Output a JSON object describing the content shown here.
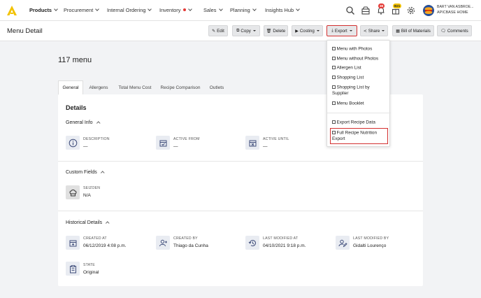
{
  "nav": {
    "items": [
      {
        "label": "Products"
      },
      {
        "label": "Procurement"
      },
      {
        "label": "Internal Ordering"
      },
      {
        "label": "Inventory"
      },
      {
        "label": "Sales"
      },
      {
        "label": "Planning"
      },
      {
        "label": "Insights Hub"
      }
    ],
    "badges": {
      "notifications": "38",
      "alerts": "B21"
    },
    "user": {
      "name": "BART VAN ASBROE...",
      "home": "APICBASE HOME"
    },
    "icons": [
      "search-icon",
      "inbox-icon",
      "bell-icon",
      "gift-icon",
      "gear-icon"
    ]
  },
  "toolbar": {
    "page_title": "Menu Detail",
    "edit": "Edit",
    "copy": "Copy",
    "delete": "Delete",
    "costing": "Costing",
    "export": "Export",
    "share": "Share",
    "bom": "Bill of Materials",
    "comments": "Comments"
  },
  "export_menu": {
    "items": [
      "Menu with Photos",
      "Menu without Photos",
      "Allergen List",
      "Shopping List",
      "Shopping List by",
      "Supplier",
      "Menu Booklet",
      "Export Recipe Data",
      "Full Recipe Nutrition",
      "Export"
    ]
  },
  "main": {
    "title": "117 menu",
    "tabs": [
      "General",
      "Allergens",
      "Total Menu Cost",
      "Recipe Comparison",
      "Outlets"
    ],
    "details_title": "Details",
    "general_info": {
      "title": "General Info",
      "description_label": "DESCRIPTION",
      "description_value": "—",
      "active_from_label": "ACTIVE FROM",
      "active_from_value": "—",
      "active_until_label": "ACTIVE UNTIL",
      "active_until_value": "—"
    },
    "custom_fields": {
      "title": "Custom Fields",
      "seizoen_label": "SEIZOEN",
      "seizoen_value": "N/A"
    },
    "historical": {
      "title": "Historical Details",
      "created_at_label": "CREATED AT",
      "created_at_value": "06/12/2019 4:08 p.m.",
      "created_by_label": "CREATED BY",
      "created_by_value": "Thiago da Cunha",
      "last_modified_at_label": "LAST MODIFIED AT",
      "last_modified_at_value": "04/10/2021 9:18 p.m.",
      "last_modified_by_label": "LAST MODIFIED BY",
      "last_modified_by_value": "Gidalti Lourenço",
      "state_label": "STATE",
      "state_value": "Original"
    }
  },
  "colors": {
    "accent": "#f2c200",
    "highlight": "#d32f2f",
    "badge_red": "#e53935",
    "icon_bg": "#e9ecf2",
    "icon_fg": "#3f4d7a"
  }
}
